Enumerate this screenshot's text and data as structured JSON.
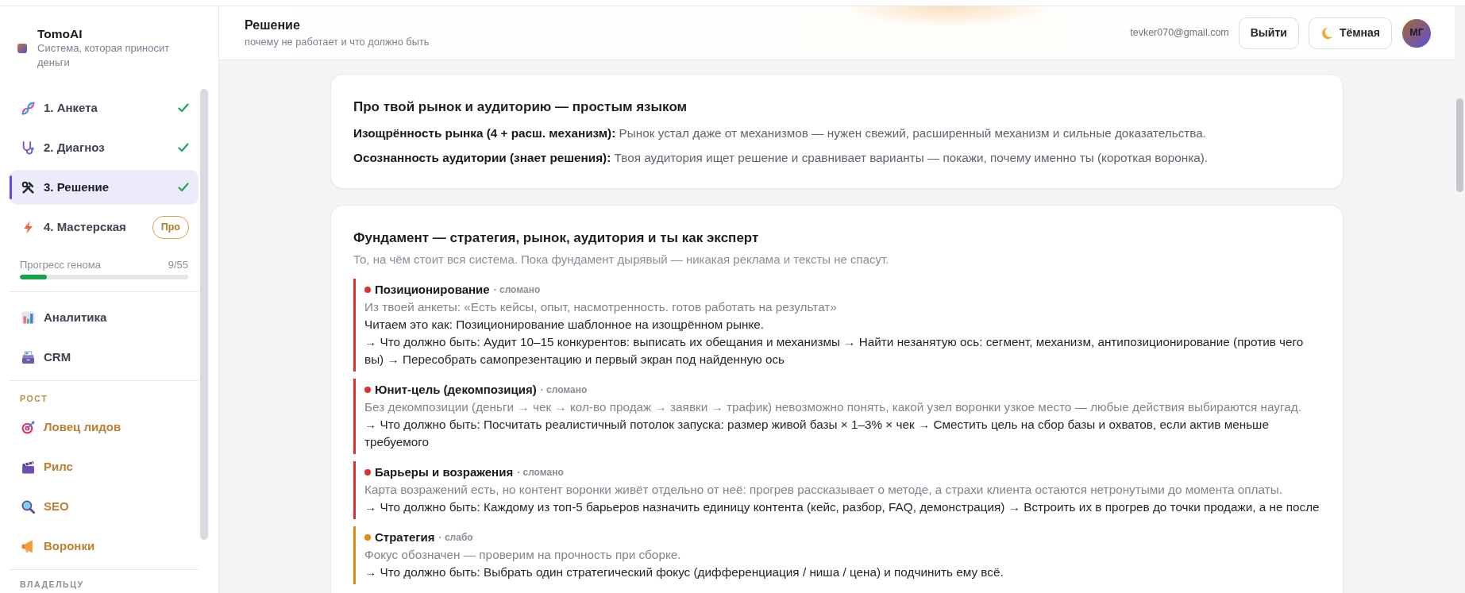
{
  "sidebar": {
    "brand": {
      "name": "TomoAI",
      "tagline": "Система, которая приносит деньги"
    },
    "steps": [
      {
        "label": "1. Анкета",
        "selected": false,
        "done": true
      },
      {
        "label": "2. Диагноз",
        "selected": false,
        "done": true
      },
      {
        "label": "3. Решение",
        "selected": true,
        "done": true
      },
      {
        "label": "4. Мастерская",
        "selected": false,
        "done": false,
        "badge": "Про"
      }
    ],
    "progress": {
      "label": "Прогресс генома",
      "count": "9/55",
      "level": 0.16
    },
    "groups": [
      {
        "kind": "plain",
        "items": [
          {
            "label": "Аналитика",
            "selected": false
          },
          {
            "label": "CRM",
            "selected": false
          }
        ]
      },
      {
        "kind": "accent",
        "title": "РОСТ",
        "items": [
          {
            "label": "Ловец лидов",
            "selected": false
          },
          {
            "label": "Рилс",
            "selected": false
          },
          {
            "label": "SEO",
            "selected": false
          },
          {
            "label": "Воронки",
            "selected": false
          }
        ]
      },
      {
        "kind": "muted",
        "title": "ВЛАДЕЛЬЦУ"
      }
    ]
  },
  "header": {
    "title": "Решение",
    "subtitle": "почему не работает и что должно быть",
    "email": "tevker070@gmail.com",
    "buttons": [
      {
        "kind": "logout",
        "label": "Выйти"
      },
      {
        "kind": "theme",
        "label": "Тёмная"
      }
    ],
    "avatar": "МГ"
  },
  "cards": [
    {
      "title": "Про твой рынок и аудиторию — простым языком",
      "facts": [
        "**Изощрённость рынка (4 + расш. механизм):** Рынок устал даже от механизмов — нужен свежий, расширенный механизм и сильные доказательства.",
        "**Осознанность аудитории (знает решения):** Твоя аудитория ищет решение и сравнивает варианты — покажи, почему именно ты (короткая воронка)."
      ]
    },
    {
      "title": "Фундамент — стратегия, рынок, аудитория и ты как эксперт",
      "subtitle": "То, на чём стоит вся система. Пока фундамент дырявый — никакая реклама и тексты не спасут.",
      "issues": [
        {
          "title": "Позиционирование",
          "status": "· сломано",
          "color": "#e03131",
          "lines": [
            {
              "kind": "note",
              "text": "Из твоей анкеты: «Есть кейсы, опыт, насмотренность. готов работать на результат»"
            },
            {
              "kind": "text",
              "text": "Читаем это как: Позиционирование шаблонное на изощрённом рынке."
            },
            {
              "kind": "text",
              "text": "→ Что должно быть: Аудит 10–15 конкурентов: выписать их обещания и механизмы → Найти незанятую ось: сегмент, механизм, антипозиционирование (против чего вы) → Пересобрать самопрезентацию и первый экран под найденную ось"
            }
          ]
        },
        {
          "title": "Юнит-цель (декомпозиция)",
          "status": "· сломано",
          "color": "#e03131",
          "lines": [
            {
              "kind": "note",
              "text": "Без декомпозиции (деньги → чек → кол-во продаж → заявки → трафик) невозможно понять, какой узел воронки узкое место — любые действия выбираются наугад."
            },
            {
              "kind": "text",
              "text": "→ Что должно быть: Посчитать реалистичный потолок запуска: размер живой базы × 1–3% × чек → Сместить цель на сбор базы и охватов, если актив меньше требуемого"
            }
          ]
        },
        {
          "title": "Барьеры и возражения",
          "status": "· сломано",
          "color": "#e03131",
          "lines": [
            {
              "kind": "note",
              "text": "Карта возражений есть, но контент воронки живёт отдельно от неё: прогрев рассказывает о методе, а страхи клиента остаются нетронутыми до момента оплаты."
            },
            {
              "kind": "text",
              "text": "→ Что должно быть: Каждому из топ-5 барьеров назначить единицу контента (кейс, разбор, FAQ, демонстрация) → Встроить их в прогрев до точки продажи, а не после"
            }
          ]
        },
        {
          "title": "Стратегия",
          "status": "· слабо",
          "color": "#e8890c",
          "lines": [
            {
              "kind": "note",
              "text": "Фокус обозначен — проверим на прочность при сборке."
            },
            {
              "kind": "text",
              "text": "→ Что должно быть: Выбрать один стратегический фокус (дифференциация / ниша / цена) и подчинить ему всё."
            }
          ]
        }
      ]
    }
  ]
}
